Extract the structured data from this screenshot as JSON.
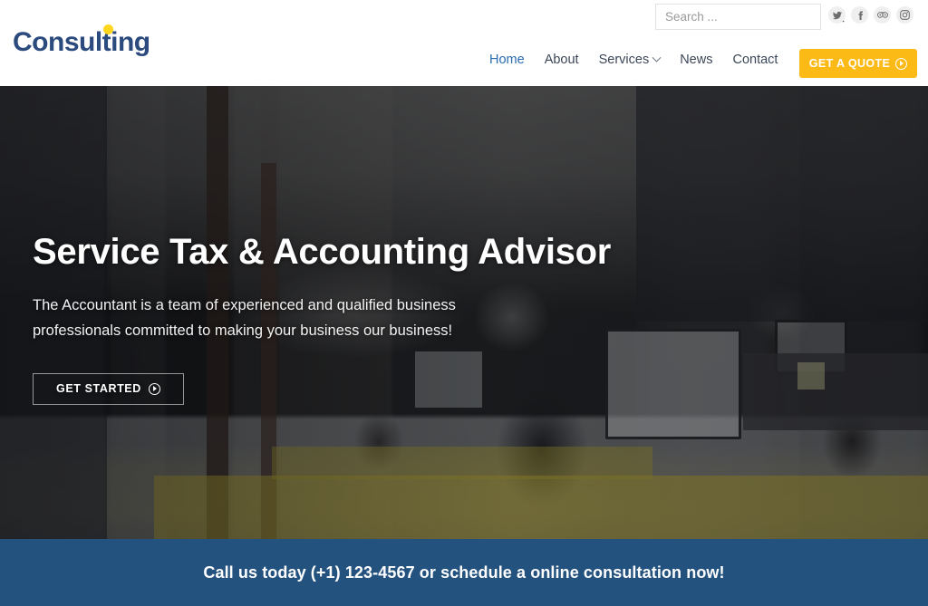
{
  "brand": {
    "name": "Consulting",
    "text_color": "#2b4a7d",
    "dot_color": "#ffd61e"
  },
  "search": {
    "placeholder": "Search ...",
    "value": "",
    "icon": "search-icon"
  },
  "socials": [
    {
      "name": "twitter",
      "icon": "twitter-icon"
    },
    {
      "name": "facebook",
      "icon": "facebook-icon"
    },
    {
      "name": "tripadvisor",
      "icon": "tripadvisor-icon"
    },
    {
      "name": "instagram",
      "icon": "instagram-icon"
    }
  ],
  "nav": {
    "items": [
      {
        "label": "Home",
        "active": true
      },
      {
        "label": "About",
        "active": false
      },
      {
        "label": "Services",
        "active": false,
        "has_submenu": true
      },
      {
        "label": "News",
        "active": false
      },
      {
        "label": "Contact",
        "active": false
      }
    ],
    "quote_button": {
      "label": "GET A QUOTE",
      "icon": "circle-arrow-right-icon",
      "color": "#fcba17"
    }
  },
  "hero": {
    "title": "Service Tax & Accounting Advisor",
    "subtitle": "The Accountant is a team of experienced and qualified business professionals committed to making your business our business!",
    "button": {
      "label": "GET STARTED",
      "icon": "circle-arrow-right-icon"
    },
    "background": "office-interior-photo"
  },
  "cta_bar": {
    "text": "Call us today (+1) 123-4567 or schedule a online consultation now!",
    "background_color": "#24527f"
  }
}
